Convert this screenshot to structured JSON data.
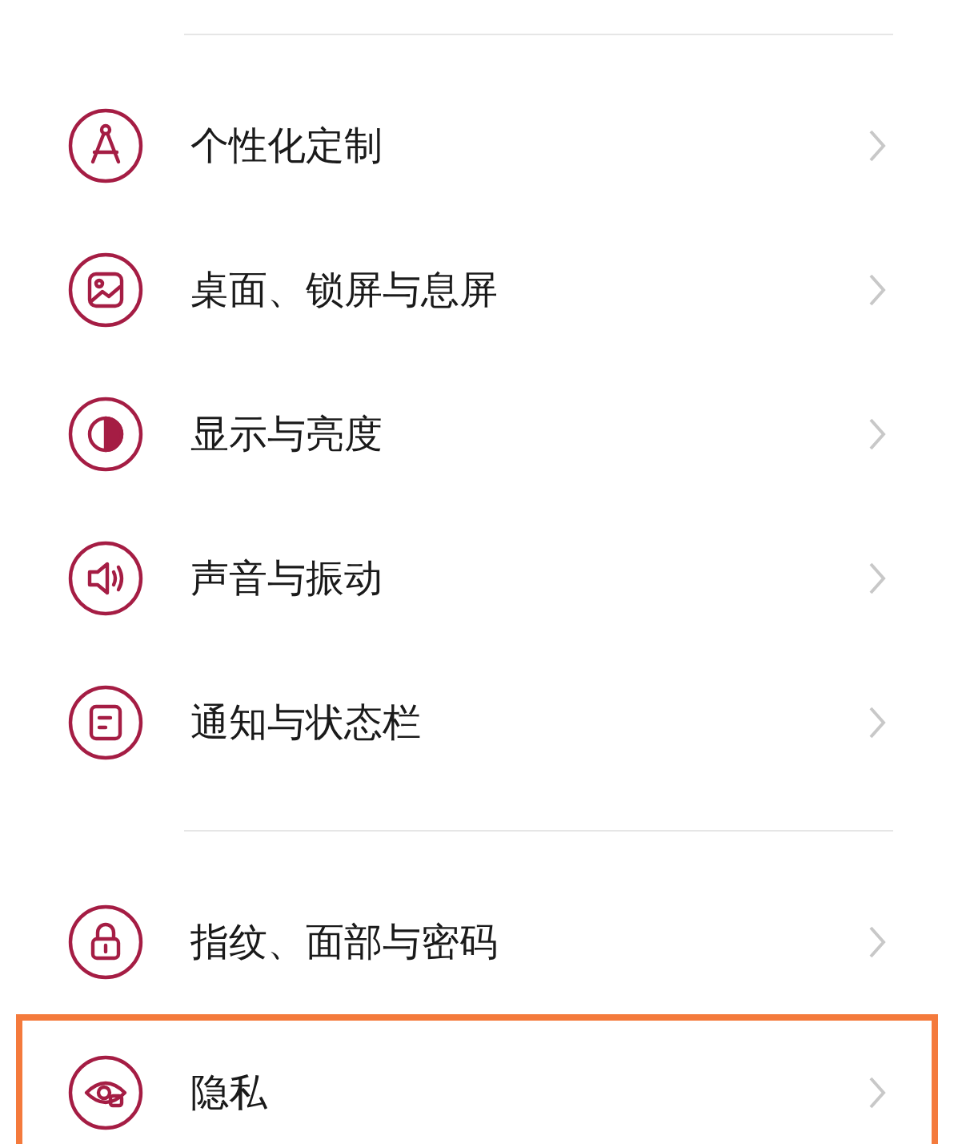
{
  "groups": [
    {
      "items": [
        {
          "label": "个性化定制",
          "highlighted": false
        },
        {
          "label": "桌面、锁屏与息屏",
          "highlighted": false
        },
        {
          "label": "显示与亮度",
          "highlighted": false
        },
        {
          "label": "声音与振动",
          "highlighted": false
        },
        {
          "label": "通知与状态栏",
          "highlighted": false
        }
      ]
    },
    {
      "items": [
        {
          "label": "指纹、面部与密码",
          "highlighted": false
        },
        {
          "label": "隐私",
          "highlighted": true
        }
      ]
    }
  ]
}
